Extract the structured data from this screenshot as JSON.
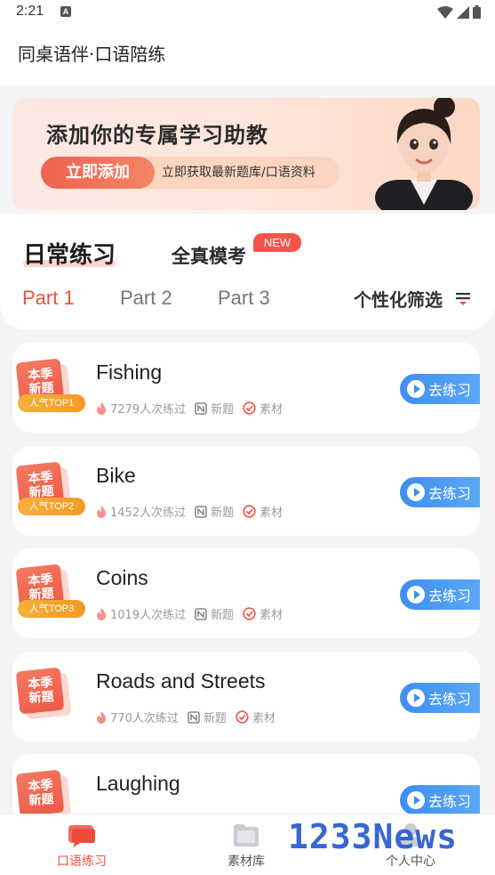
{
  "status_bar": {
    "time": "2:21",
    "badge_letter": "A"
  },
  "app": {
    "title": "同桌语伴·口语陪练"
  },
  "banner": {
    "title": "添加你的专属学习助教",
    "button_label": "立即添加",
    "subtitle": "立即获取最新题库/口语资料"
  },
  "tabs": {
    "daily": "日常练习",
    "mock": "全真模考",
    "new_badge": "NEW",
    "parts": [
      "Part 1",
      "Part 2",
      "Part 3"
    ],
    "filter": "个性化筛选"
  },
  "topics": [
    {
      "tag": "本季新题",
      "rank": "人气TOP1",
      "title": "Fishing",
      "count": "7279人次练过",
      "new": "新题",
      "material": "素材",
      "button": "去练习"
    },
    {
      "tag": "本季新题",
      "rank": "人气TOP2",
      "title": "Bike",
      "count": "1452人次练过",
      "new": "新题",
      "material": "素材",
      "button": "去练习"
    },
    {
      "tag": "本季新题",
      "rank": "人气TOP3",
      "title": "Coins",
      "count": "1019人次练过",
      "new": "新题",
      "material": "素材",
      "button": "去练习"
    },
    {
      "tag": "本季新题",
      "rank": "",
      "title": "Roads and Streets",
      "count": "770人次练过",
      "new": "新题",
      "material": "素材",
      "button": "去练习"
    },
    {
      "tag": "本季新题",
      "rank": "",
      "title": "Laughing",
      "count": "",
      "new": "",
      "material": "",
      "button": "去练习"
    }
  ],
  "bottom_nav": [
    {
      "label": "口语练习",
      "icon": "chat-bubble-icon",
      "active": true
    },
    {
      "label": "素材库",
      "icon": "folder-icon",
      "active": false
    },
    {
      "label": "个人中心",
      "icon": "person-icon",
      "active": false
    }
  ],
  "watermark": "1233News",
  "colors": {
    "accent": "#f0503f",
    "practice_blue": "#3d8ef0",
    "rank_orange": "#f39a23"
  }
}
